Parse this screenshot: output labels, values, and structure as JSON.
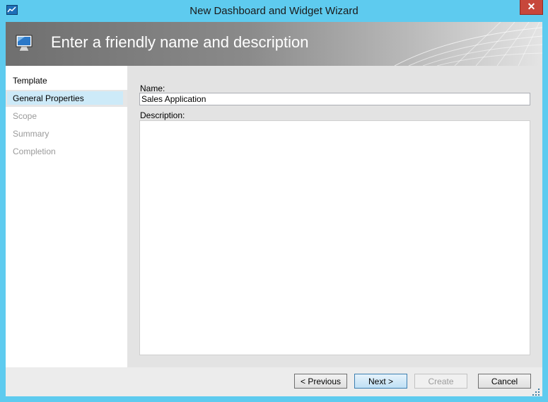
{
  "window": {
    "title": "New Dashboard and Widget Wizard",
    "accent_color": "#5ecbef",
    "close_icon": "close-icon"
  },
  "banner": {
    "title": "Enter a friendly name and description",
    "icon": "monitor-icon"
  },
  "sidebar": {
    "items": [
      {
        "label": "Template",
        "state": "normal"
      },
      {
        "label": "General Properties",
        "state": "selected"
      },
      {
        "label": "Scope",
        "state": "disabled"
      },
      {
        "label": "Summary",
        "state": "disabled"
      },
      {
        "label": "Completion",
        "state": "disabled"
      }
    ]
  },
  "form": {
    "name_label": "Name:",
    "name_value": "Sales Application",
    "description_label": "Description:",
    "description_value": ""
  },
  "buttons": {
    "previous": "< Previous",
    "next": "Next >",
    "create": "Create",
    "cancel": "Cancel"
  }
}
